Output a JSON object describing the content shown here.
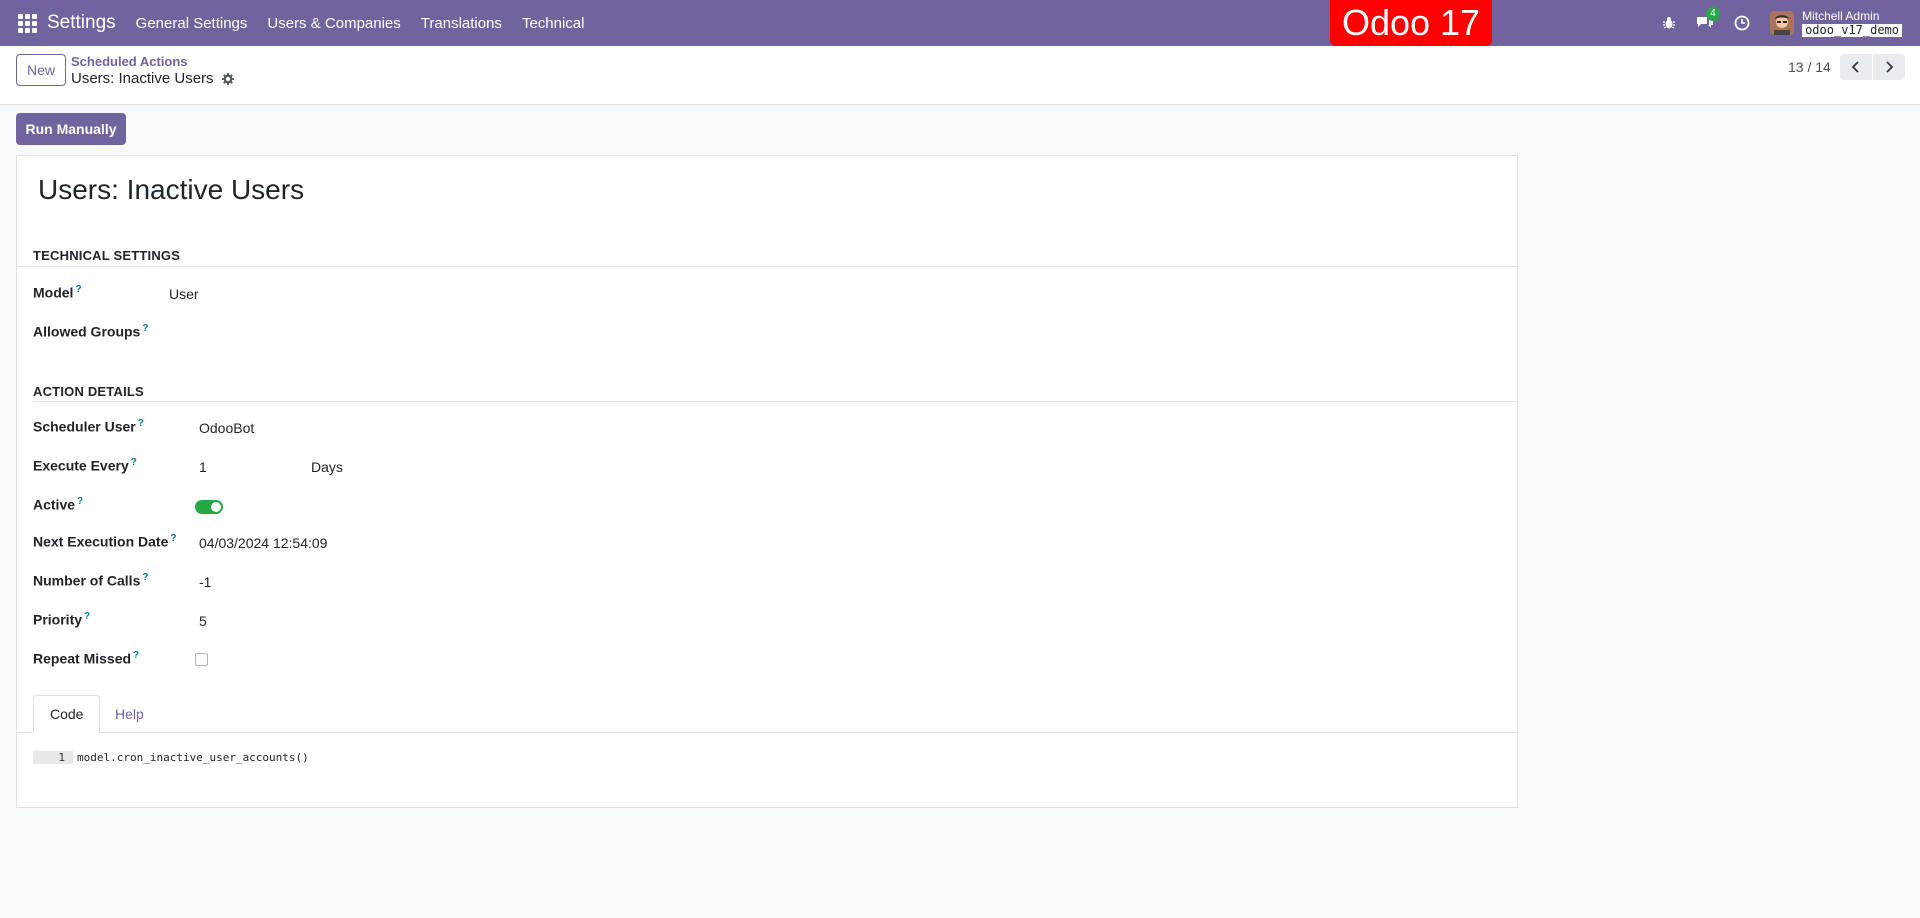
{
  "navbar": {
    "app_name": "Settings",
    "menus": [
      "General Settings",
      "Users & Companies",
      "Translations",
      "Technical"
    ],
    "badge_text": "Odoo 17",
    "chat_count": "4",
    "user_name": "Mitchell Admin",
    "db_name": "odoo_v17_demo",
    "accent": "#71639e"
  },
  "control_panel": {
    "new_label": "New",
    "breadcrumb_parent": "Scheduled Actions",
    "breadcrumb_current": "Users: Inactive Users",
    "pager": "13 / 14"
  },
  "actions": {
    "run_manually": "Run Manually"
  },
  "form": {
    "title": "Users: Inactive Users",
    "technical_settings": {
      "heading": "TECHNICAL SETTINGS",
      "model_label": "Model",
      "model_value": "User",
      "allowed_groups_label": "Allowed Groups"
    },
    "action_details": {
      "heading": "ACTION DETAILS",
      "scheduler_user_label": "Scheduler User",
      "scheduler_user_value": "OdooBot",
      "execute_every_label": "Execute Every",
      "execute_every_value": "1",
      "execute_every_unit": "Days",
      "active_label": "Active",
      "active_value": true,
      "next_execution_label": "Next Execution Date",
      "next_execution_value": "04/03/2024 12:54:09",
      "number_of_calls_label": "Number of Calls",
      "number_of_calls_value": "-1",
      "priority_label": "Priority",
      "priority_value": "5",
      "repeat_missed_label": "Repeat Missed",
      "repeat_missed_value": false
    },
    "tabs": [
      "Code",
      "Help"
    ],
    "code": {
      "line_number": "1",
      "line_text": "model.cron_inactive_user_accounts()"
    }
  }
}
